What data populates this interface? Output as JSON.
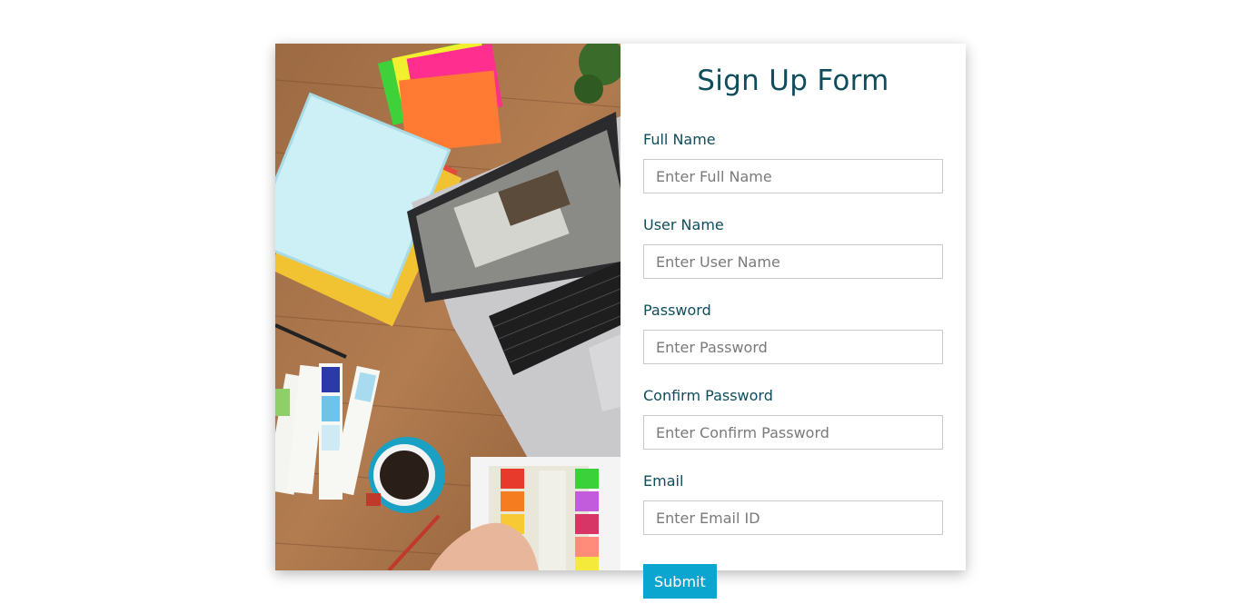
{
  "form": {
    "title": "Sign Up Form",
    "fields": [
      {
        "label": "Full Name",
        "placeholder": "Enter Full Name",
        "value": ""
      },
      {
        "label": "User Name",
        "placeholder": "Enter User Name",
        "value": ""
      },
      {
        "label": "Password",
        "placeholder": "Enter Password",
        "value": ""
      },
      {
        "label": "Confirm Password",
        "placeholder": "Enter Confirm Password",
        "value": ""
      },
      {
        "label": "Email",
        "placeholder": "Enter Email ID",
        "value": ""
      }
    ],
    "submit_label": "Submit"
  },
  "colors": {
    "title": "#0f4d5c",
    "accent": "#0aa6cf",
    "input_border": "#c9c9c9"
  },
  "image": {
    "subject": "workspace-desk-photo"
  }
}
